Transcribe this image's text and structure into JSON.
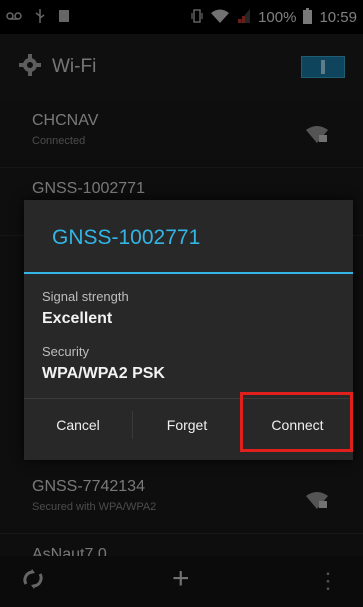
{
  "status_bar": {
    "battery_percent": "100%",
    "time": "10:59",
    "icons": [
      "voicemail-icon",
      "usb-icon",
      "image-icon",
      "vibrate-icon",
      "wifi-signal-icon",
      "cell-signal-icon",
      "battery-icon"
    ]
  },
  "action_bar": {
    "title": "Wi-Fi",
    "icon": "gear-icon",
    "toggle_state": "on",
    "accent": "#33b5e5"
  },
  "networks": [
    {
      "ssid": "CHCNAV",
      "status": "Connected"
    },
    {
      "ssid": "GNSS-1002771",
      "status": ""
    },
    {
      "ssid": "GNSS-7742134",
      "status": "Secured with WPA/WPA2"
    },
    {
      "ssid": "AsNaut7.0",
      "status": ""
    }
  ],
  "dialog": {
    "title": "GNSS-1002771",
    "signal_label": "Signal strength",
    "signal_value": "Excellent",
    "security_label": "Security",
    "security_value": "WPA/WPA2 PSK",
    "buttons": {
      "cancel": "Cancel",
      "forget": "Forget",
      "connect": "Connect"
    },
    "highlight_color": "#e0201d"
  },
  "bottom_bar": {
    "icons": [
      "wps-icon",
      "add-network-icon",
      "overflow-menu-icon"
    ]
  }
}
